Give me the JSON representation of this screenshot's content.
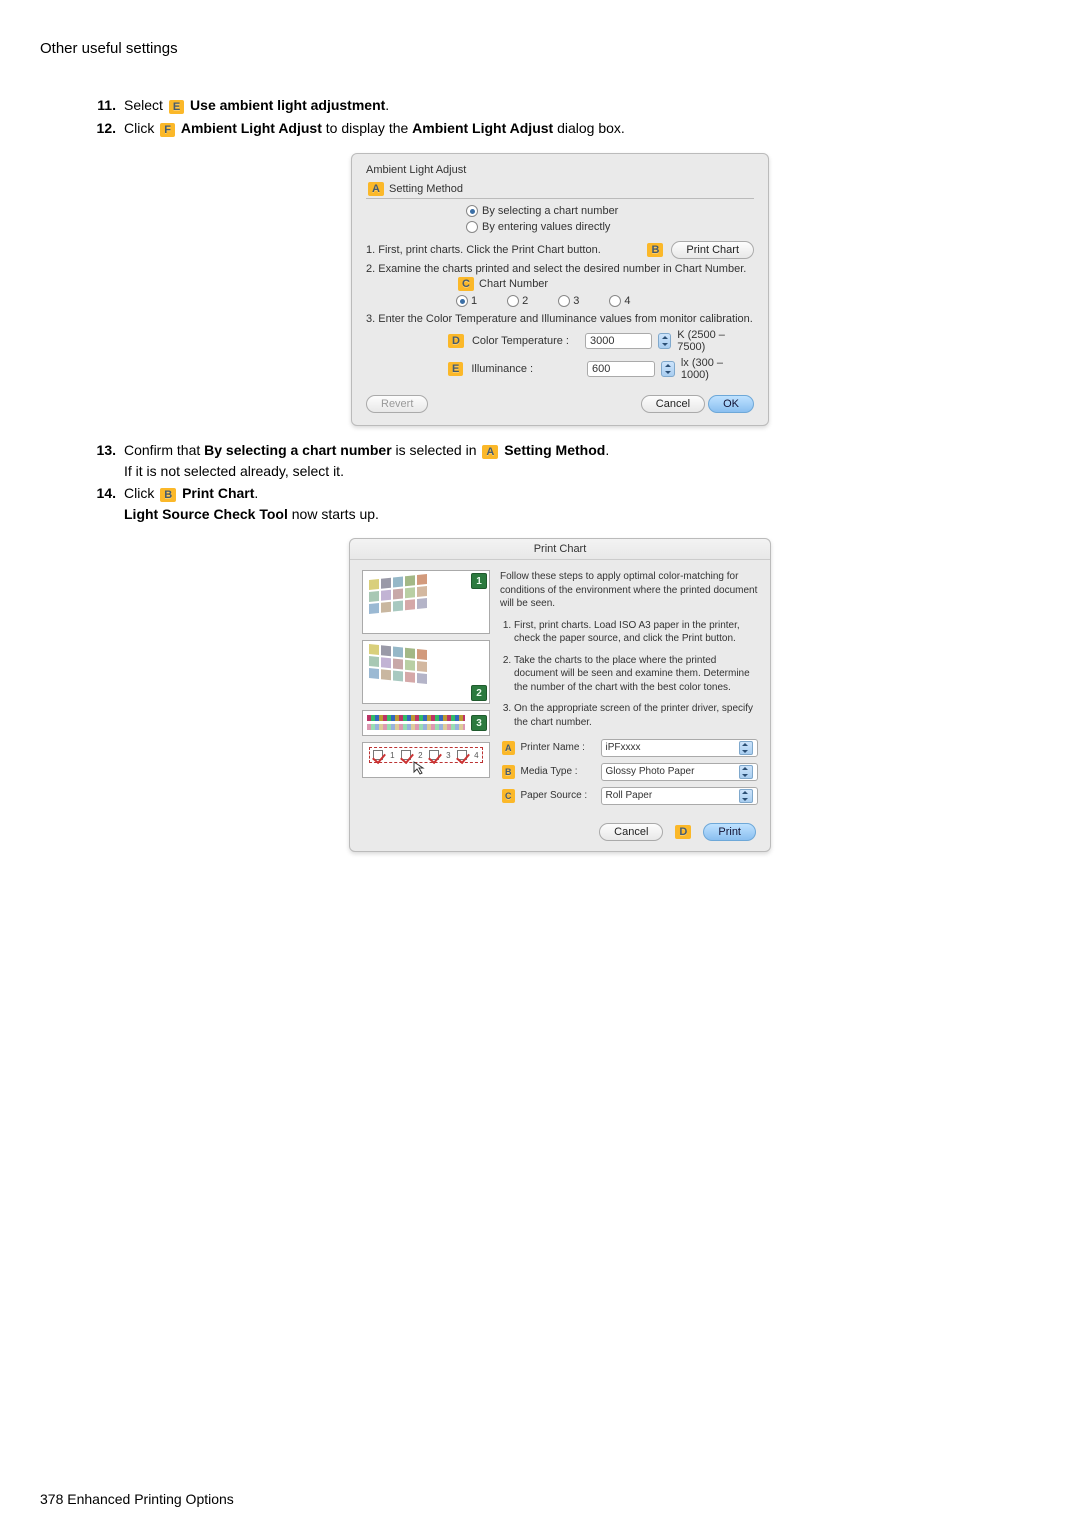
{
  "header": "Other useful settings",
  "steps": {
    "s11": {
      "num": "11.",
      "pre": "Select ",
      "badge": "E",
      "bold": " Use ambient light adjustment",
      "post": "."
    },
    "s12": {
      "num": "12.",
      "pre": "Click ",
      "badge": "F",
      "bold1": " Ambient Light Adjust",
      "mid": " to display the ",
      "bold2": "Ambient Light Adjust",
      "post": " dialog box."
    },
    "s13": {
      "num": "13.",
      "pre": "Confirm that ",
      "bold1": "By selecting a chart number",
      "mid": " is selected in ",
      "badge": "A",
      "bold2": " Setting Method",
      "post": ".",
      "line2": "If it is not selected already, select it."
    },
    "s14": {
      "num": "14.",
      "pre": "Click ",
      "badge": "B",
      "bold1": " Print Chart",
      "post": ".",
      "line2a": "Light Source Check Tool",
      "line2b": " now starts up."
    }
  },
  "dialog1": {
    "title": "Ambient Light Adjust",
    "group_badge": "A",
    "group_label": " Setting Method",
    "radio1": "By selecting a chart number",
    "radio2": "By entering values directly",
    "step1": "1. First, print charts. Click the Print Chart button.",
    "print_chart_badge": "B",
    "print_chart_btn": "Print Chart",
    "step2": "2. Examine the charts printed and select the desired number in Chart Number.",
    "chart_num_badge": "C",
    "chart_num_label": " Chart Number",
    "opts": [
      "1",
      "2",
      "3",
      "4"
    ],
    "step3": "3. Enter the Color Temperature and Illuminance values from monitor calibration.",
    "ct_badge": "D",
    "ct_label": " Color Temperature :",
    "ct_value": "3000",
    "ct_range": "K (2500 – 7500)",
    "il_badge": "E",
    "il_label": " Illuminance :",
    "il_value": "600",
    "il_range": "lx (300 – 1000)",
    "revert": "Revert",
    "cancel": "Cancel",
    "ok": "OK"
  },
  "dialog2": {
    "title": "Print Chart",
    "intro": "Follow these steps to apply optimal color-matching for conditions of the environment where the printed document will be seen.",
    "li1": "First, print charts. Load ISO A3 paper in the printer, check the paper source, and click the Print button.",
    "li2": "Take the charts to the place where the printed document will be seen and examine them. Determine the number of the chart with the best color tones.",
    "li3": "On the appropriate screen of the printer driver, specify the chart number.",
    "thumb_badges": [
      "1",
      "2",
      "3"
    ],
    "t4_nums": [
      "1",
      "2",
      "3",
      "4"
    ],
    "printer_badge": "A",
    "printer_label": "Printer Name :",
    "printer_value": "iPFxxxx",
    "media_badge": "B",
    "media_label": "Media Type :",
    "media_value": "Glossy Photo Paper",
    "paper_badge": "C",
    "paper_label": "Paper Source :",
    "paper_value": "Roll Paper",
    "cancel": "Cancel",
    "print_badge": "D",
    "print": "Print"
  },
  "footer": {
    "page": "378",
    "section": " Enhanced Printing Options"
  },
  "swatch_colors": [
    "#d9cf7b",
    "#9a9aa8",
    "#96b8c8",
    "#a3b886",
    "#d29a7c",
    "#a8c8b4",
    "#c2b3d4",
    "#c8a8a8",
    "#b9cfa4",
    "#d3b8a0",
    "#9bb9d3",
    "#c9b7a0",
    "#a8c9c0",
    "#d5a8a8",
    "#b4b4c8"
  ]
}
